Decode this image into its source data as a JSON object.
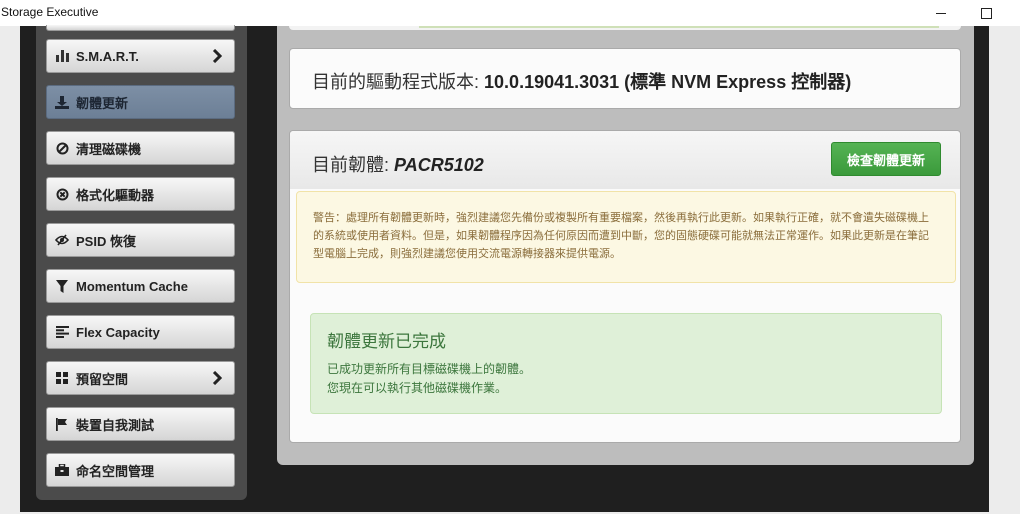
{
  "window": {
    "title": "Storage Executive",
    "minimize_label": "—",
    "maximize_label": "☐"
  },
  "sidebar": {
    "items": [
      {
        "label": "S.M.A.R.T.",
        "icon": "bar-chart-icon",
        "has_submenu": true
      },
      {
        "label": "韌體更新",
        "icon": "download-icon",
        "active": true
      },
      {
        "label": "清理磁碟機",
        "icon": "ban-icon"
      },
      {
        "label": "格式化驅動器",
        "icon": "circle-x-icon"
      },
      {
        "label": "PSID 恢復",
        "icon": "eye-slash-icon"
      },
      {
        "label": "Momentum Cache",
        "icon": "filter-icon"
      },
      {
        "label": "Flex Capacity",
        "icon": "align-left-icon"
      },
      {
        "label": "預留空間",
        "icon": "grid-icon",
        "has_submenu": true
      },
      {
        "label": "裝置自我測試",
        "icon": "flag-icon"
      },
      {
        "label": "命名空間管理",
        "icon": "briefcase-icon"
      }
    ]
  },
  "driver": {
    "label": "目前的驅動程式版本:",
    "value": "10.0.19041.3031 (標準 NVM Express 控制器)"
  },
  "firmware": {
    "label": "目前韌體:",
    "value": "PACR5102",
    "check_button": "檢查韌體更新",
    "warning": "警告：處理所有韌體更新時，強烈建議您先備份或複製所有重要檔案，然後再執行此更新。如果執行正確，就不會遺失磁碟機上的系統或使用者資料。但是，如果韌體程序因為任何原因而遭到中斷，您的固態硬碟可能就無法正常運作。如果此更新是在筆記型電腦上完成，則強烈建議您使用交流電源轉接器來提供電源。",
    "success_title": "韌體更新已完成",
    "success_line1": "已成功更新所有目標磁碟機上的韌體。",
    "success_line2": "您現在可以執行其他磁碟機作業。"
  },
  "colors": {
    "success_button": "#44a644",
    "warning_bg": "#fcf8e3",
    "success_bg": "#dff0d8",
    "active_nav": "#7589a0"
  }
}
